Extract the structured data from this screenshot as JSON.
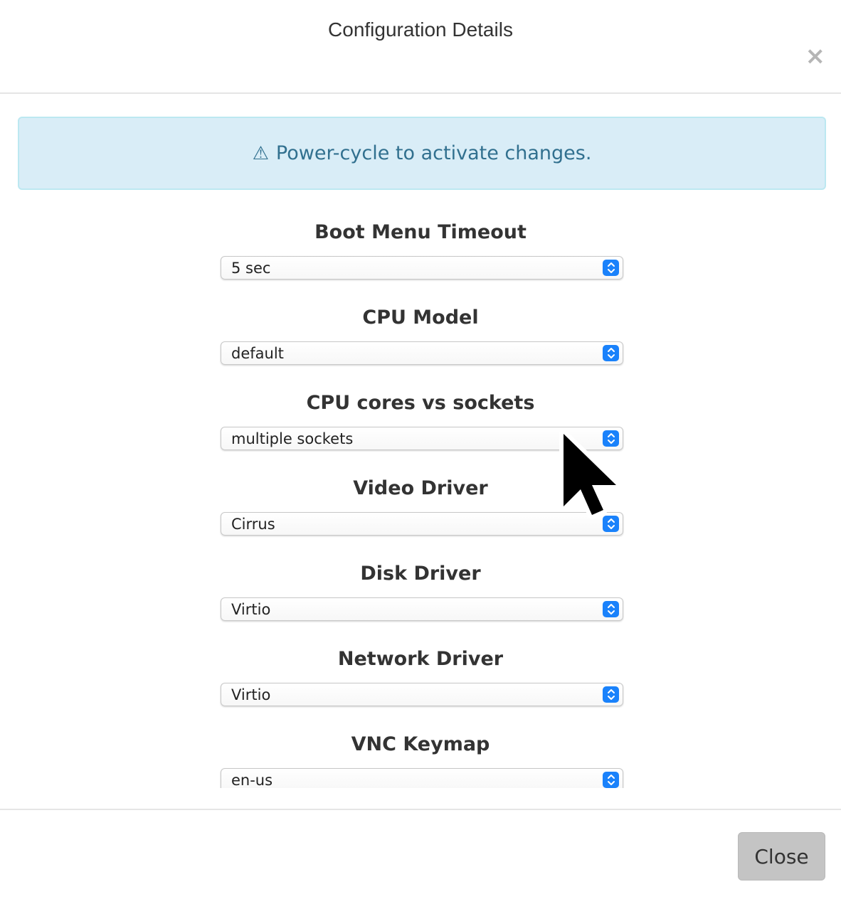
{
  "dialog": {
    "title": "Configuration Details",
    "close_icon": "×"
  },
  "alert": {
    "icon": "⚠",
    "message": "Power-cycle to activate changes."
  },
  "fields": [
    {
      "label": "Boot Menu Timeout",
      "value": "5 sec"
    },
    {
      "label": "CPU Model",
      "value": "default"
    },
    {
      "label": "CPU cores vs sockets",
      "value": "multiple sockets"
    },
    {
      "label": "Video Driver",
      "value": "Cirrus"
    },
    {
      "label": "Disk Driver",
      "value": "Virtio"
    },
    {
      "label": "Network Driver",
      "value": "Virtio"
    },
    {
      "label": "VNC Keymap",
      "value": "en-us"
    }
  ],
  "footer": {
    "close_label": "Close"
  },
  "colors": {
    "alert_background": "#d9edf7",
    "alert_text": "#31708f",
    "select_arrow_accent": "#1a82fb",
    "close_button": "#c4c4c4"
  },
  "icons": {
    "alert": "warning-icon",
    "dialog_close": "close-icon",
    "select_arrows": "chevron-updown-icon",
    "pointer": "mouse-cursor-icon"
  }
}
